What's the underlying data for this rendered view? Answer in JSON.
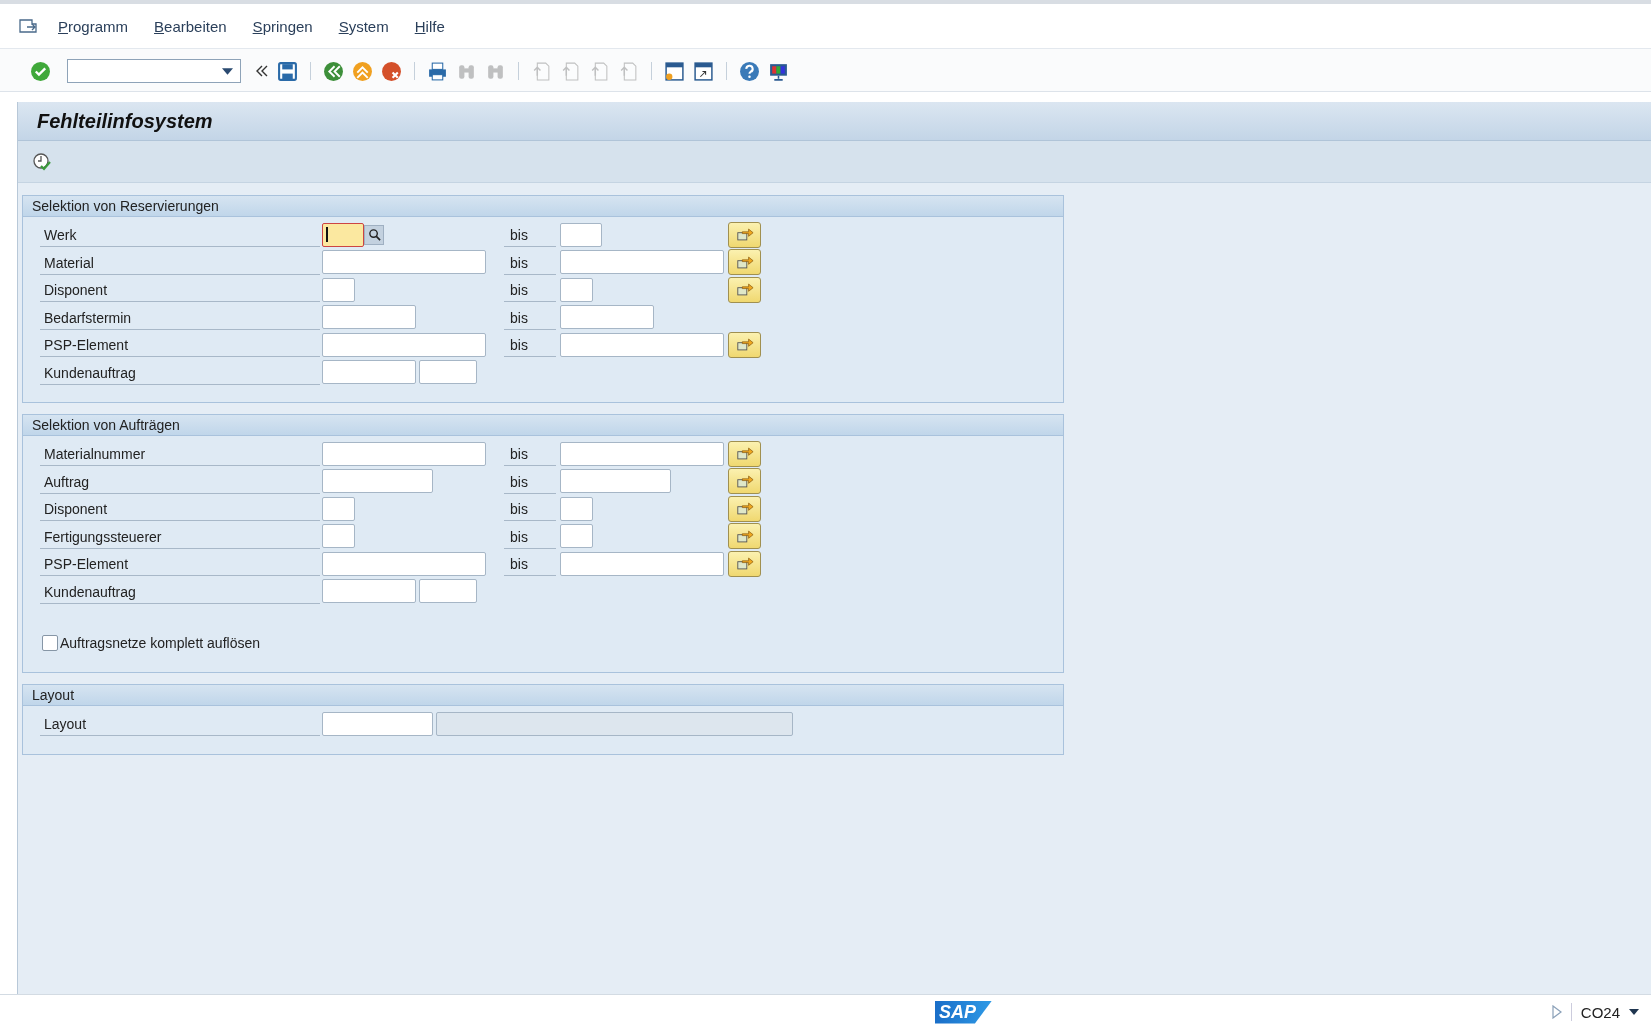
{
  "menu": {
    "items": [
      "Programm",
      "Bearbeiten",
      "Springen",
      "System",
      "Hilfe"
    ]
  },
  "toolbar": {
    "buttons": [
      {
        "disabled": false
      },
      {
        "disabled": false
      },
      {
        "disabled": false
      },
      {
        "disabled": false
      },
      {
        "disabled": false
      },
      {
        "disabled": false
      },
      {
        "disabled": false
      },
      {
        "disabled": true
      },
      {
        "disabled": true
      },
      {
        "disabled": true
      },
      {
        "disabled": true
      },
      {
        "disabled": true
      },
      {
        "disabled": true
      },
      {
        "disabled": false
      },
      {
        "disabled": false
      },
      {
        "disabled": false
      }
    ]
  },
  "title": "Fehlteilinfosystem",
  "sections": [
    {
      "title": "Selektion von Reservierungen",
      "rows": [
        {
          "label": "Werk",
          "kind": "range",
          "to_label": "bis",
          "focused": true,
          "multiple_selection": true
        },
        {
          "label": "Material",
          "kind": "range",
          "to_label": "bis",
          "focused": false,
          "multiple_selection": true
        },
        {
          "label": "Disponent",
          "kind": "range",
          "to_label": "bis",
          "focused": false,
          "multiple_selection": true
        },
        {
          "label": "Bedarfstermin",
          "kind": "range",
          "to_label": "bis",
          "focused": false,
          "multiple_selection": false
        },
        {
          "label": "PSP-Element",
          "kind": "range",
          "to_label": "bis",
          "focused": false,
          "multiple_selection": true
        },
        {
          "label": "Kundenauftrag",
          "kind": "pair",
          "focused": false
        }
      ]
    },
    {
      "title": "Selektion von Aufträgen",
      "rows": [
        {
          "label": "Materialnummer",
          "kind": "range",
          "to_label": "bis",
          "focused": false,
          "multiple_selection": true
        },
        {
          "label": "Auftrag",
          "kind": "range",
          "to_label": "bis",
          "focused": false,
          "multiple_selection": true
        },
        {
          "label": "Disponent",
          "kind": "range",
          "to_label": "bis",
          "focused": false,
          "multiple_selection": true
        },
        {
          "label": "Fertigungssteuerer",
          "kind": "range",
          "to_label": "bis",
          "focused": false,
          "multiple_selection": true
        },
        {
          "label": "PSP-Element",
          "kind": "range",
          "to_label": "bis",
          "focused": false,
          "multiple_selection": true
        },
        {
          "label": "Kundenauftrag",
          "kind": "pair",
          "focused": false
        },
        {
          "label": "Auftragsnetze komplett auflösen",
          "kind": "checkbox",
          "checked": false
        }
      ]
    },
    {
      "title": "Layout",
      "rows": [
        {
          "label": "Layout",
          "kind": "display",
          "focused": false
        }
      ]
    }
  ],
  "status_bar": {
    "logo": "SAP",
    "transaction": "CO24"
  }
}
